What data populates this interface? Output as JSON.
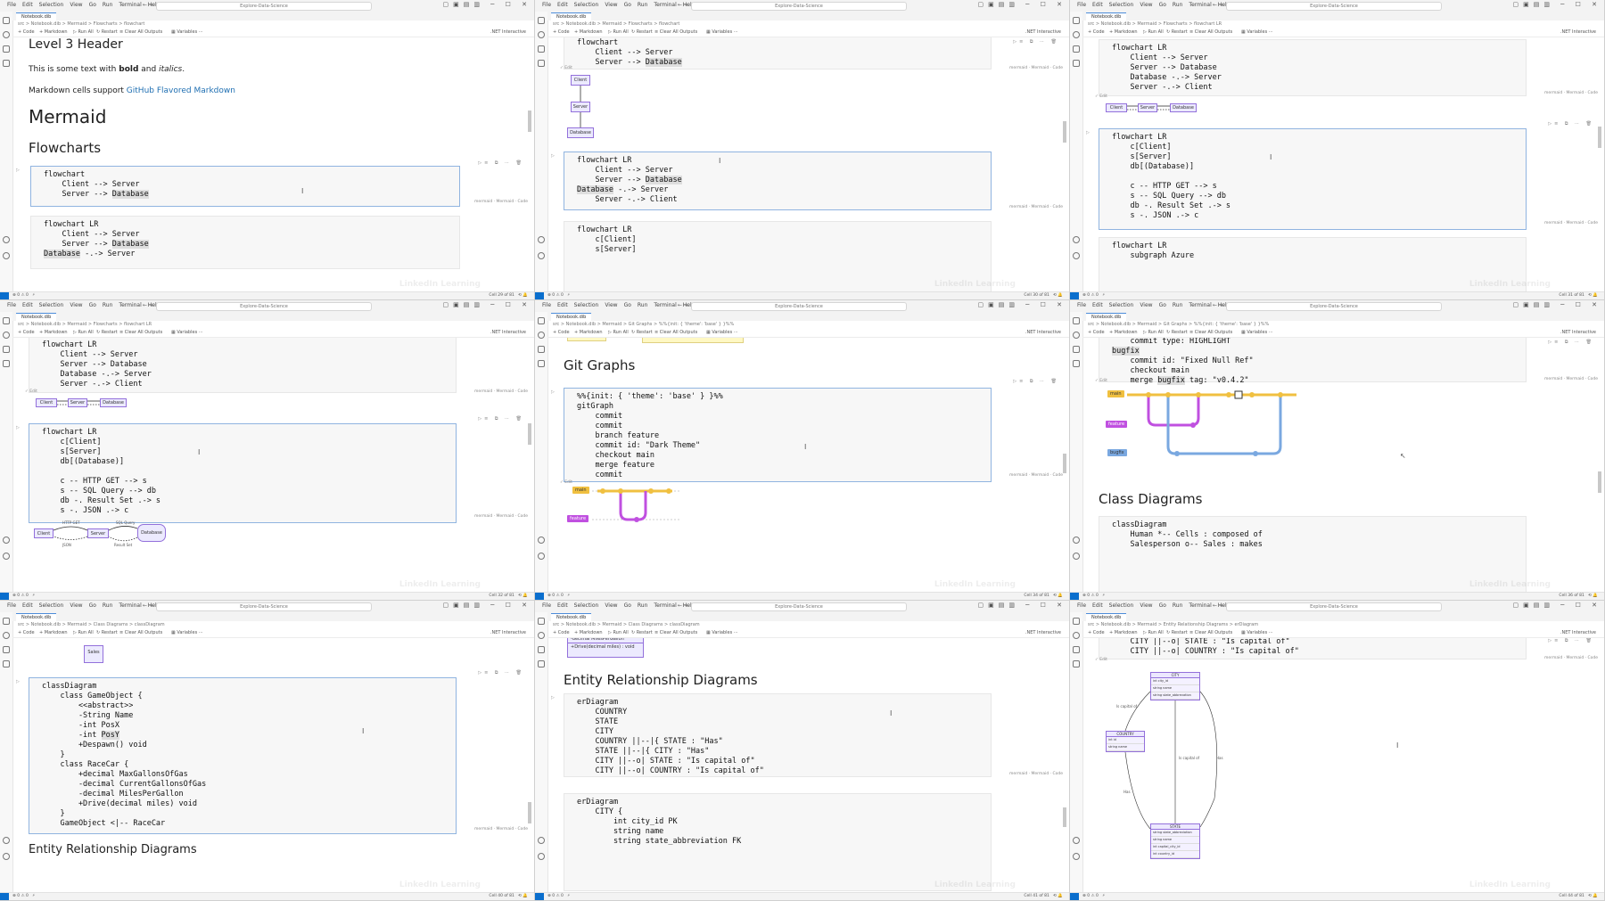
{
  "window": {
    "menu": [
      "File",
      "Edit",
      "Selection",
      "View",
      "Go",
      "Run",
      "Terminal",
      "Help"
    ],
    "command_center": "Explore-Data-Science",
    "tab": "Notebook.dib",
    "toolbar": [
      "Code",
      "Markdown",
      "Run All",
      "Restart",
      "Clear All Outputs",
      "Variables"
    ],
    "kernel": ".NET Interactive",
    "cell_lang": "mermaid · Mermaid · Code",
    "watermark": "LinkedIn Learning",
    "edit_label": "Edit"
  },
  "panes": [
    {
      "breadcrumb": "src > Notebook.dib > Mermaid > Flowcharts > flowchart",
      "status_right": "Cell 29 of 81",
      "heading_level3": "Level 3 Header",
      "para1_prefix": "This is some text with ",
      "para1_bold": "bold",
      "para1_mid": " and ",
      "para1_italic": "italics",
      "para1_suffix": ".",
      "para2_prefix": "Markdown cells support ",
      "para2_link": "GitHub Flavored Markdown",
      "heading_mermaid": "Mermaid",
      "heading_flowcharts": "Flowcharts",
      "cell1": [
        "flowchart",
        "    Client --> Server",
        "    Server --> "
      ],
      "cell1_hl": "Database",
      "cell2": [
        "flowchart LR",
        "    Client --> Server",
        "    Server --> "
      ],
      "cell2_hl": "Database",
      "cell2_last_hl": "Database",
      "cell2_last_rest": " -.-> Server"
    },
    {
      "breadcrumb": "src > Notebook.dib > Mermaid > Flowcharts > flowchart",
      "status_right": "Cell 30 of 81",
      "cell_top": [
        "flowchart",
        "    Client --> Server",
        "    Server --> "
      ],
      "cell_top_hl": "Database",
      "nodes": [
        "Client",
        "Server",
        "Database"
      ],
      "cell_mid": [
        "flowchart LR",
        "    Client --> Server",
        "    Server --> "
      ],
      "cell_mid_hl": "Database",
      "cell_mid_line4_hl": "Database",
      "cell_mid_line4_rest": " -.-> Server",
      "cell_mid_line5": "    Server -.-> Client",
      "cell_bottom": [
        "flowchart LR",
        "    c[Client]",
        "    s[Server]"
      ]
    },
    {
      "breadcrumb": "src > Notebook.dib > Mermaid > Flowcharts > flowchart LR",
      "status_right": "Cell 31 of 81",
      "cell_top": [
        "flowchart LR",
        "    Client --> Server",
        "    Server --> Database",
        "    Database -.-> Server",
        "    Server -.-> Client"
      ],
      "nodes": [
        "Client",
        "Server",
        "Database"
      ],
      "cell_mid": [
        "flowchart LR",
        "    c[Client]",
        "    s[Server]",
        "    db[(Database)]",
        "",
        "    c -- HTTP GET --> s",
        "    s -- SQL Query --> db",
        "    db -. Result Set .-> s",
        "    s -. JSON .-> c"
      ],
      "cell_bottom": [
        "flowchart LR",
        "    subgraph Azure"
      ]
    },
    {
      "breadcrumb": "src > Notebook.dib > Mermaid > Flowcharts > flowchart LR",
      "status_right": "Cell 32 of 81",
      "cell_top": [
        "flowchart LR",
        "    Client --> Server",
        "    Server --> Database",
        "    Database -.-> Server",
        "    Server -.-> Client"
      ],
      "nodes": [
        "Client",
        "Server",
        "Database"
      ],
      "cell_mid": [
        "flowchart LR",
        "    c[Client]",
        "    s[Server]",
        "    db[(Database)]",
        "",
        "    c -- HTTP GET --> s",
        "    s -- SQL Query --> db",
        "    db -. Result Set .-> s",
        "    s -. JSON .-> c"
      ],
      "edge_labels": [
        "HTTP GET",
        "SQL Query",
        "JSON",
        "Result Set"
      ]
    },
    {
      "breadcrumb": "src > Notebook.dib > Mermaid > Git Graphs > %%{init: { 'theme': 'base' } }%%",
      "status_right": "Cell 34 of 81",
      "heading": "Git Graphs",
      "cell": [
        "%%{init: { 'theme': 'base' } }%%",
        "gitGraph",
        "    commit",
        "    commit",
        "    branch feature",
        "    commit id: \"Dark Theme\"",
        "    checkout main",
        "    merge feature",
        "    commit"
      ],
      "branches": [
        "main",
        "feature"
      ]
    },
    {
      "breadcrumb": "src > Notebook.dib > Mermaid > Git Graphs > %%{init: { 'theme': 'base' } }%%",
      "status_right": "Cell 36 of 81",
      "cell_top": [
        "    checkout bugfix",
        "    commit id: \"Fixed Null Ref\"",
        "    checkout main",
        "    merge "
      ],
      "cell_top_first_prefix": "    commit type: HIGHLIGHT",
      "cell_top_bugfix_hl": "bugfix",
      "cell_top_merge_hl": "bugfix",
      "cell_top_merge_rest": " tag: \"v0.4.2\"",
      "branches": [
        "main",
        "feature",
        "bugfix"
      ],
      "heading": "Class Diagrams",
      "cell_bottom": [
        "classDiagram",
        "    Human *-- Cells : composed of",
        "    Salesperson o-- Sales : makes"
      ]
    },
    {
      "breadcrumb": "src > Notebook.dib > Mermaid > Class Diagrams > classDiagram",
      "status_right": "Cell 40 of 81",
      "class_node": "Sales",
      "cell": [
        "classDiagram",
        "    class GameObject {",
        "        <<abstract>>",
        "        -String Name",
        "        -int PosX",
        "        -int ",
        "        +Despawn() void",
        "    }",
        "    class RaceCar {",
        "        +decimal MaxGallonsOfGas",
        "        -decimal CurrentGallonsOfGas",
        "        -decimal MilesPerGallon",
        "        +Drive(decimal miles) void",
        "    }",
        "    GameObject <|-- RaceCar"
      ],
      "cell_hl": "PosY",
      "heading": "Entity Relationship Diagrams"
    },
    {
      "breadcrumb": "src > Notebook.dib > Mermaid > Class Diagrams > classDiagram",
      "status_right": "Cell 41 of 81",
      "class_rows": [
        "-decimal MilesPerGallon",
        "+Drive(decimal miles) : void"
      ],
      "heading": "Entity Relationship Diagrams",
      "cell_mid": [
        "erDiagram",
        "    COUNTRY",
        "    STATE",
        "    CITY",
        "    COUNTRY ||--|{ STATE : \"Has\"",
        "    STATE ||--|{ CITY : \"Has\"",
        "    CITY ||--o| STATE : \"Is capital of\"",
        "    CITY ||--o| COUNTRY : \"Is capital of\""
      ],
      "cell_bottom": [
        "erDiagram",
        "    CITY {",
        "        int city_id PK",
        "        string name",
        "        string state_abbreviation FK"
      ]
    },
    {
      "breadcrumb": "src > Notebook.dib > Mermaid > Entity Relationship Diagrams > erDiagram",
      "status_right": "Cell 44 of 81",
      "cell_top": [
        "    CITY ||--o| STATE : \"Is capital of\"",
        "    CITY ||--o| COUNTRY : \"Is capital of\""
      ],
      "entities": [
        {
          "name": "CITY",
          "rows": [
            "int city_id",
            "string name",
            "string state_abbrevation"
          ]
        },
        {
          "name": "COUNTRY",
          "rows": [
            "int id",
            "string name"
          ]
        },
        {
          "name": "STATE",
          "rows": [
            "string state_abbreviation",
            "string name",
            "int capital_city_id",
            "int country_id"
          ]
        }
      ],
      "relations": [
        "Is capital of",
        "Is capital of",
        "Has",
        "Has"
      ]
    }
  ]
}
